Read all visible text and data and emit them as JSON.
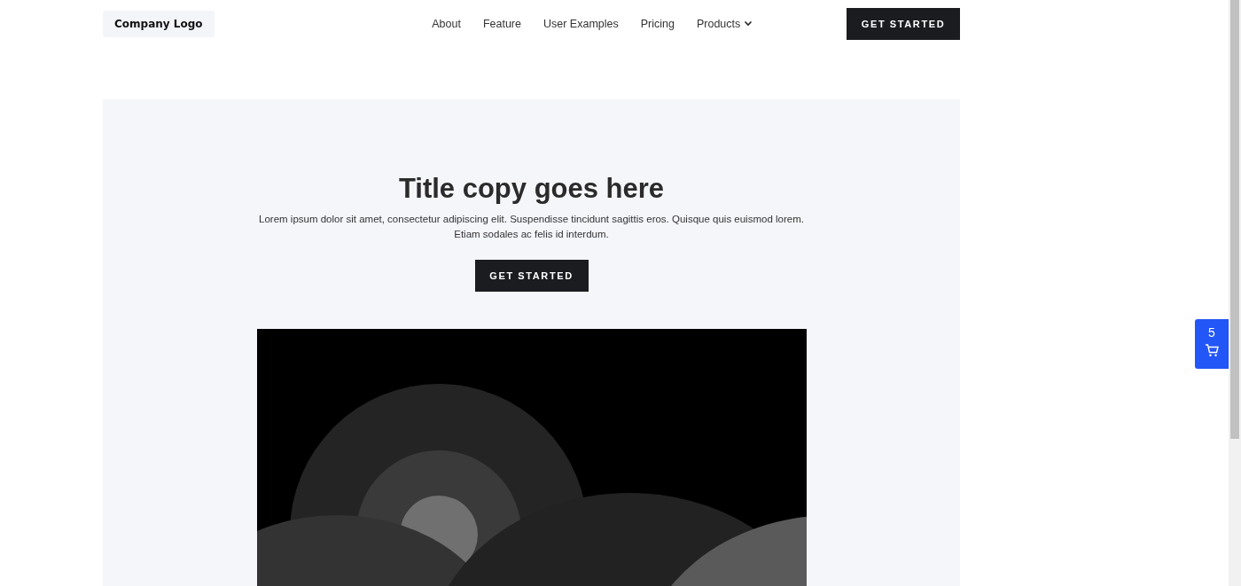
{
  "header": {
    "logo": "Company Logo",
    "nav": [
      {
        "label": "About",
        "kind": "link"
      },
      {
        "label": "Feature",
        "kind": "link"
      },
      {
        "label": "User Examples",
        "kind": "link"
      },
      {
        "label": "Pricing",
        "kind": "link"
      },
      {
        "label": "Products",
        "kind": "dropdown"
      }
    ],
    "cta": "GET STARTED"
  },
  "hero": {
    "title": "Title copy goes here",
    "body": "Lorem ipsum dolor sit amet, consectetur adipiscing elit. Suspendisse tincidunt sagittis eros. Quisque quis euismod lorem. Etiam sodales ac felis id interdum.",
    "cta": "GET STARTED"
  },
  "cart": {
    "count": "5"
  }
}
